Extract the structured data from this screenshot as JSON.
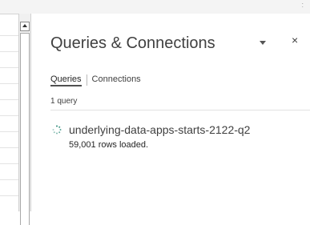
{
  "window": {
    "corner_mark": ":"
  },
  "pane": {
    "title": "Queries & Connections",
    "dropdown_icon": "chevron-down-icon",
    "close_icon": "close-icon",
    "close_glyph": "×"
  },
  "tabs": [
    {
      "label": "Queries",
      "active": true
    },
    {
      "label": "Connections",
      "active": false
    }
  ],
  "query_count": "1 query",
  "queries": [
    {
      "name": "underlying-data-apps-starts-2122-q2",
      "status": "59,001 rows loaded.",
      "icon": "loading-spinner-icon"
    }
  ],
  "colors": {
    "text": "#404040",
    "scrollbar": "#f0f0f0",
    "accent": "#2e8b7a"
  }
}
